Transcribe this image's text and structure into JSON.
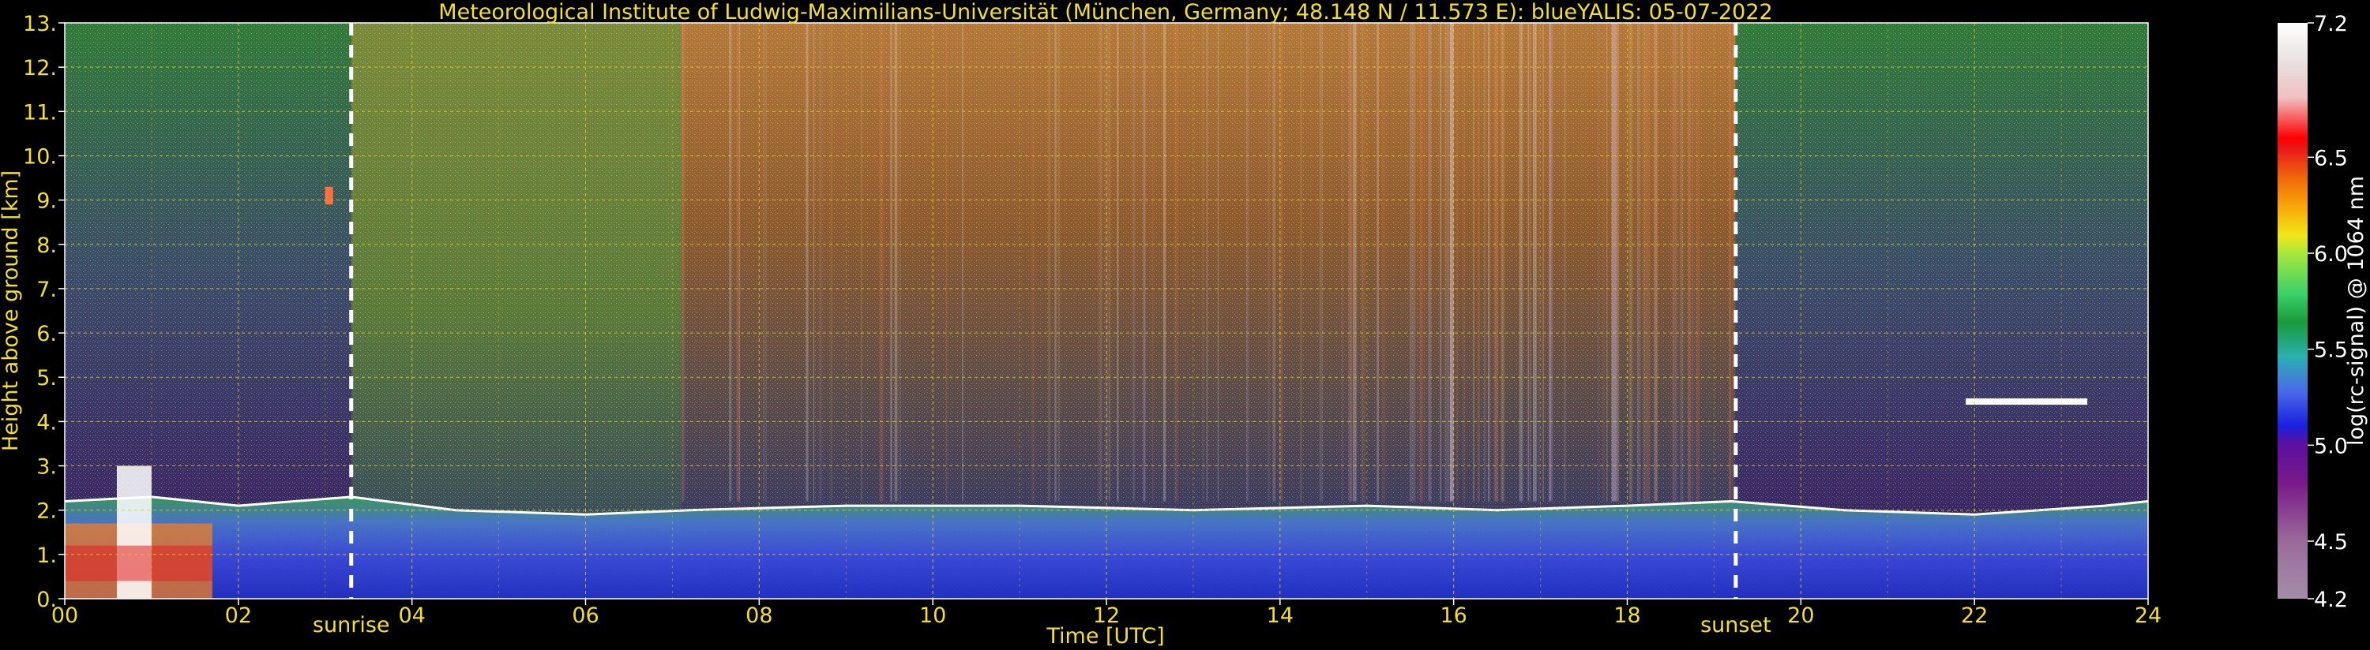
{
  "chart_data": {
    "type": "heatmap",
    "title": "Meteorological Institute of Ludwig-Maximilians-Universität (München, Germany; 48.148 N / 11.573 E):     blueYALIS: 05-07-2022",
    "xlabel": "Time [UTC]",
    "ylabel": "Height above ground [km]",
    "xlim": [
      0,
      24
    ],
    "ylim": [
      0,
      13
    ],
    "x_ticks": [
      0,
      2,
      4,
      6,
      8,
      10,
      12,
      14,
      16,
      18,
      20,
      22,
      24
    ],
    "x_tick_labels": [
      "00",
      "02",
      "04",
      "06",
      "08",
      "10",
      "12",
      "14",
      "16",
      "18",
      "20",
      "22",
      "24"
    ],
    "y_ticks": [
      0,
      1,
      2,
      3,
      4,
      5,
      6,
      7,
      8,
      9,
      10,
      11,
      12,
      13
    ],
    "y_tick_labels": [
      "0.",
      "1.",
      "2.",
      "3.",
      "4.",
      "5.",
      "6.",
      "7.",
      "8.",
      "9.",
      "10.",
      "11.",
      "12.",
      "13."
    ],
    "grid": true,
    "annotations": [
      {
        "text": "sunrise",
        "x": 3.3
      },
      {
        "text": "sunset",
        "x": 19.25
      }
    ],
    "colorbar": {
      "label": "log(rc-signal) @ 1064 nm",
      "range": [
        4.2,
        7.2
      ],
      "tick_values": [
        4.2,
        4.5,
        5.0,
        5.5,
        6.0,
        6.5,
        7.2
      ],
      "tick_labels": [
        "4.2",
        "4.5",
        "5.0",
        "5.5",
        "6.0",
        "6.5",
        "7.2"
      ]
    },
    "features": {
      "boundary_layer_top_km": [
        {
          "x": 0.0,
          "y": 2.2
        },
        {
          "x": 1.0,
          "y": 2.3
        },
        {
          "x": 2.0,
          "y": 2.1
        },
        {
          "x": 3.3,
          "y": 2.3
        },
        {
          "x": 4.5,
          "y": 2.0
        },
        {
          "x": 6.0,
          "y": 1.9
        },
        {
          "x": 7.2,
          "y": 2.0
        },
        {
          "x": 9.0,
          "y": 2.1
        },
        {
          "x": 11.0,
          "y": 2.1
        },
        {
          "x": 13.0,
          "y": 2.0
        },
        {
          "x": 15.0,
          "y": 2.1
        },
        {
          "x": 16.5,
          "y": 2.0
        },
        {
          "x": 18.0,
          "y": 2.1
        },
        {
          "x": 19.2,
          "y": 2.2
        },
        {
          "x": 20.5,
          "y": 2.0
        },
        {
          "x": 22.0,
          "y": 1.9
        },
        {
          "x": 23.5,
          "y": 2.1
        },
        {
          "x": 24.0,
          "y": 2.2
        }
      ],
      "cloud_layer_km": {
        "x_start": 21.9,
        "x_end": 23.3,
        "y": 4.45
      }
    }
  }
}
